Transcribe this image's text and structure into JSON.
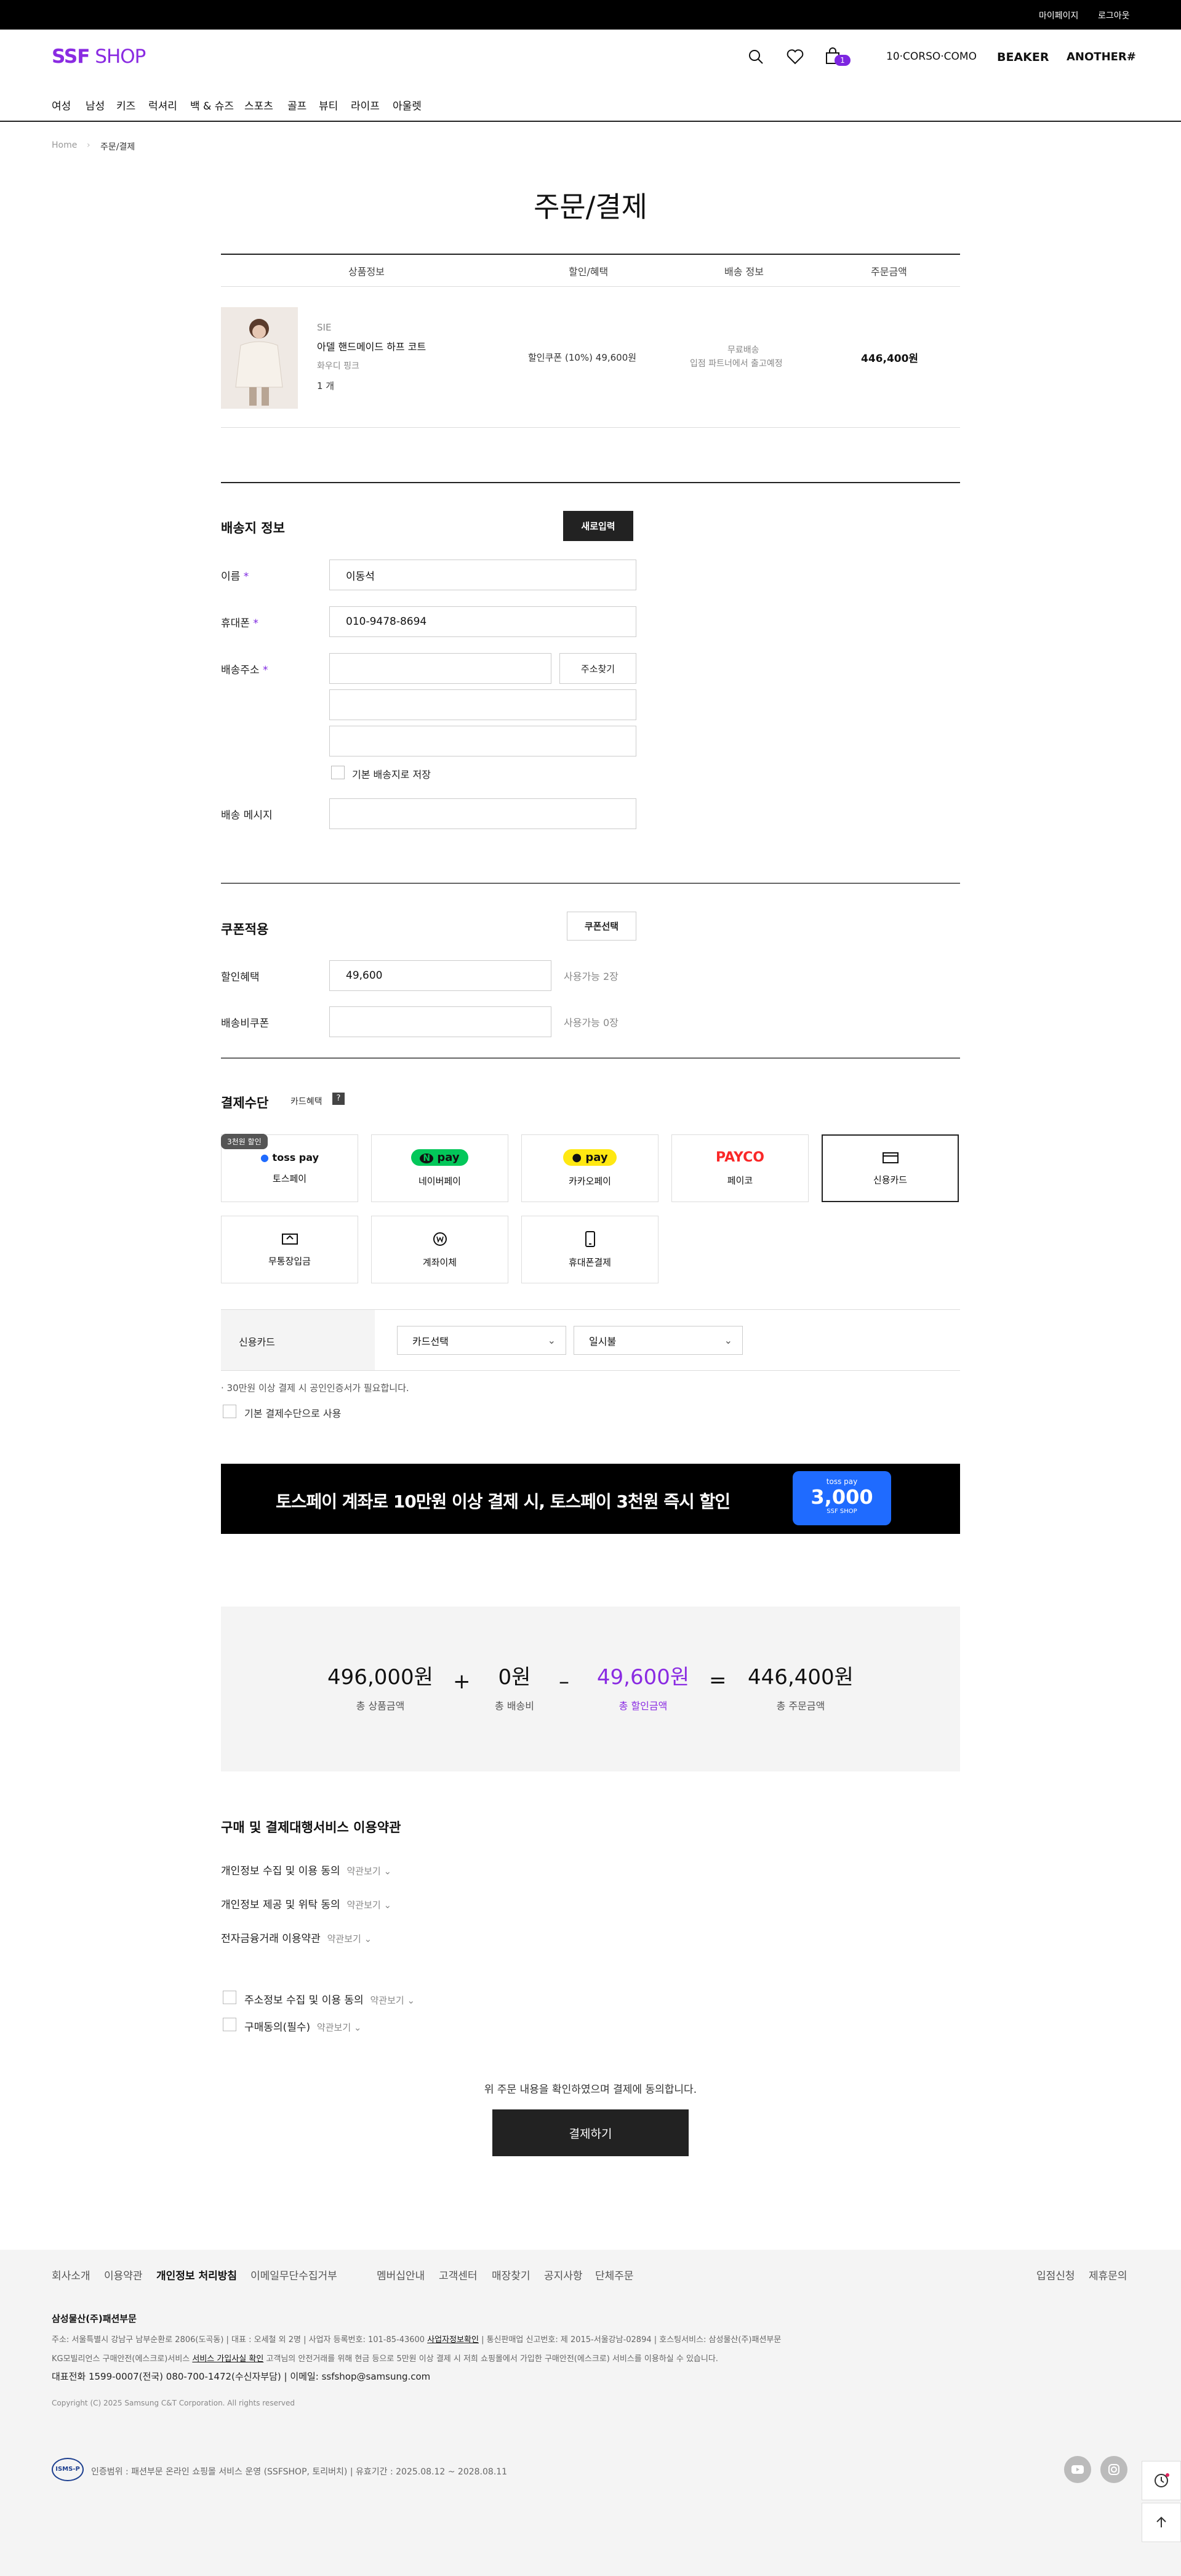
{
  "topbar": {
    "mypage": "마이페이지",
    "logout": "로그아웃"
  },
  "header": {
    "logo_main": "SSF",
    "logo_sub": " SHOP",
    "cart_count": "1",
    "brands": [
      "10·CORSO·COMO",
      "BEAKER",
      "ANOTHER#"
    ]
  },
  "gnb": [
    "여성",
    "남성",
    "키즈",
    "럭셔리",
    "백 & 슈즈",
    "스포츠",
    "골프",
    "뷰티",
    "라이프",
    "아울렛"
  ],
  "breadcrumb": {
    "home": "Home",
    "current": "주문/결제"
  },
  "page_title": "주문/결제",
  "order_table": {
    "headers": [
      "상품정보",
      "할인/혜택",
      "배송 정보",
      "주문금액"
    ],
    "item": {
      "brand": "SIE",
      "name": "아델 핸드메이드 하프 코트",
      "option": "화우디 핑크",
      "qty": "1 개",
      "discount": "할인쿠폰 (10%) 49,600원",
      "shipping1": "무료배송",
      "shipping2": "입점 파트너에서 출고예정",
      "price": "446,400원"
    }
  },
  "shipping": {
    "title": "배송지 정보",
    "new_button": "새로입력",
    "name_label": "이름",
    "name_value": "이동석",
    "phone_label": "휴대폰",
    "phone_value": "010-9478-8694",
    "address_label": "배송주소",
    "address_search": "주소찾기",
    "default_save": "기본 배송지로 저장",
    "message_label": "배송 메시지"
  },
  "coupon": {
    "title": "쿠폰적용",
    "select_button": "쿠폰선택",
    "discount_label": "할인혜택",
    "discount_value": "49,600",
    "discount_avail": "사용가능 2장",
    "ship_label": "배송비쿠폰",
    "ship_avail": "사용가능 0장"
  },
  "payment": {
    "title": "결제수단",
    "card_benefit": "카드혜택",
    "help": "?",
    "promo_badge": "3천원 할인",
    "methods": [
      {
        "logo": "toss pay",
        "label": "토스페이"
      },
      {
        "logo": "pay",
        "label": "네이버페이"
      },
      {
        "logo": "pay",
        "label": "카카오페이"
      },
      {
        "logo": "PAYCO",
        "label": "페이코"
      },
      {
        "logo": "",
        "label": "신용카드"
      },
      {
        "logo": "",
        "label": "무통장입금"
      },
      {
        "logo": "",
        "label": "계좌이체"
      },
      {
        "logo": "",
        "label": "휴대폰결제"
      }
    ],
    "naver_n": "N",
    "card_label": "신용카드",
    "card_select": "카드선택",
    "installment_select": "일시불",
    "notice": "30만원 이상 결제 시 공인인증서가 필요합니다.",
    "default_method": "기본 결제수단으로 사용"
  },
  "banner": {
    "text": "토스페이 계좌로 10만원 이상 결제 시, 토스페이 3천원 즉시 할인",
    "card_top": "toss pay",
    "card_amount": "3,000",
    "card_bottom": "SSF SHOP"
  },
  "summary": {
    "total_goods": "496,000원",
    "total_goods_label": "총 상품금액",
    "shipping": "0원",
    "shipping_label": "총 배송비",
    "discount": "49,600원",
    "discount_label": "총 할인금액",
    "total": "446,400원",
    "total_label": "총 주문금액",
    "plus": "+",
    "minus": "–",
    "equals": "="
  },
  "terms": {
    "title": "구매 및 결제대행서비스 이용약관",
    "items": [
      "개인정보 수집 및 이용 동의",
      "개인정보 제공 및 위탁 동의",
      "전자금융거래 이용약관"
    ],
    "view": "약관보기",
    "checks": [
      "주소정보 수집 및 이용 동의",
      "구매동의(필수)"
    ],
    "confirm": "위 주문 내용을 확인하였으며 결제에 동의합니다.",
    "pay_button": "결제하기"
  },
  "footer": {
    "links": [
      "회사소개",
      "이용약관",
      "개인정보 처리방침",
      "이메일무단수집거부",
      "멤버십안내",
      "고객센터",
      "매장찾기",
      "공지사항",
      "단체주문"
    ],
    "right_links": [
      "입점신청",
      "제휴문의"
    ],
    "company": "삼성물산(주)패션부문",
    "info1": "주소: 서울특별시 강남구 남부순환로 2806(도곡동)   |   대표 : 오세철 외 2명   |   사업자 등록번호: 101-85-43600",
    "info1_link": "사업자정보확인",
    "info1b": "   |   통신판매업 신고번호: 제 2015-서울강남-02894   |   호스팅서비스: 삼성물산(주)패션부문",
    "info2a": "KG모빌리언스 구매안전(에스크로)서비스",
    "info2_link": "서비스 가입사실 확인",
    "info2b": " 고객님의 안전거래를 위해 현금 등으로 5만원 이상 결제 시 저희 쇼핑몰에서 가입한 구매안전(에스크로) 서비스를 이용하실 수 있습니다.",
    "contact": "대표전화 1599-0007(전국) 080-700-1472(수신자부담) | 이메일: ssfshop@samsung.com",
    "copyright": "Copyright (C) 2025 Samsung C&T Corporation. All rights reserved",
    "isms_logo": "ISMS-P",
    "isms": "인증범위 : 패션부문 온라인 쇼핑몰 서비스 운영 (SSFSHOP, 토리버치)  |  유효기간 : 2025.08.12 ~ 2028.08.11"
  }
}
